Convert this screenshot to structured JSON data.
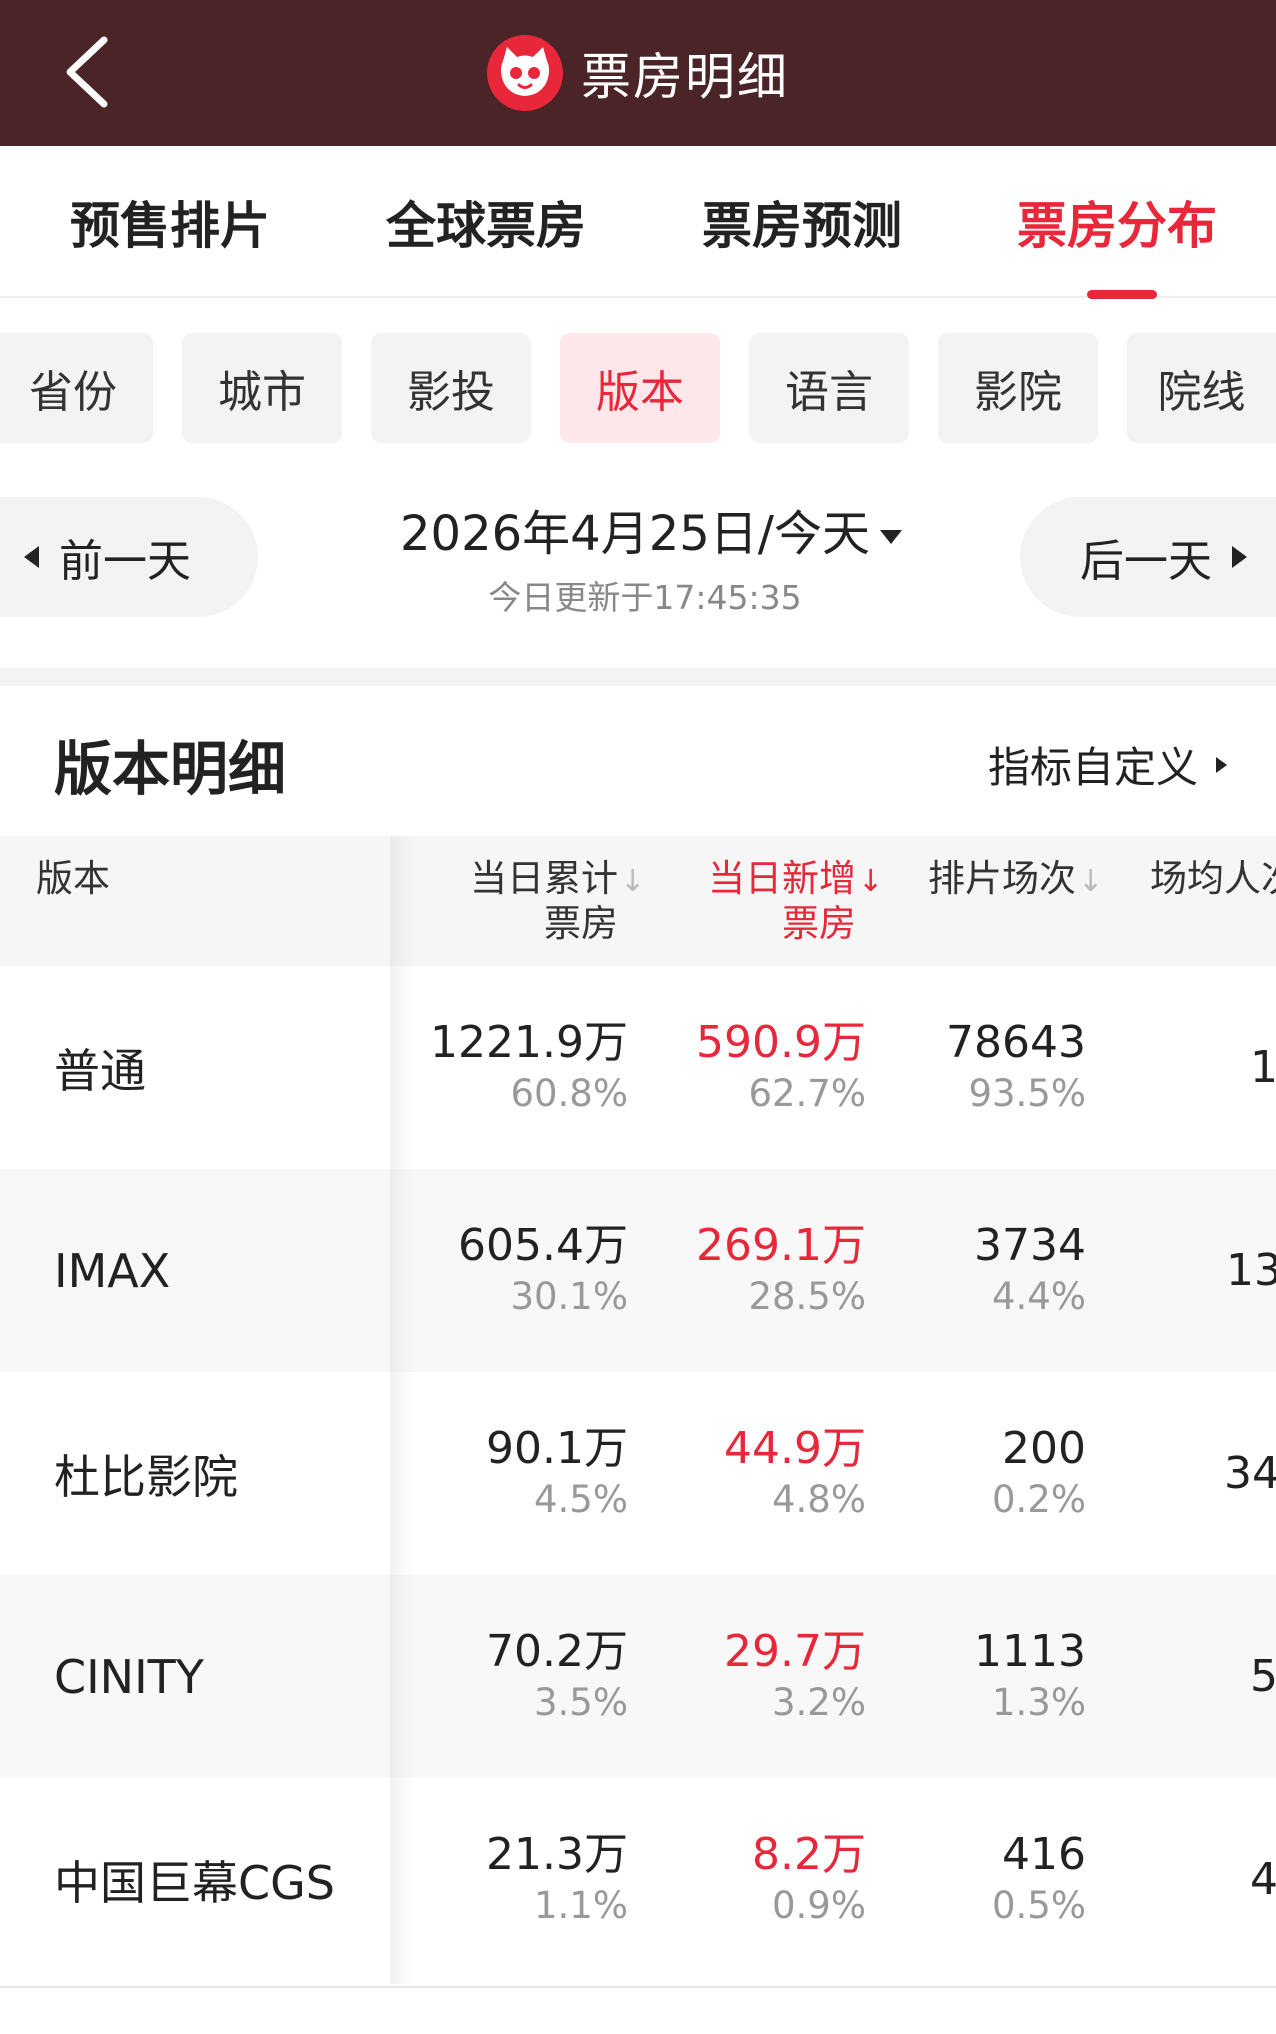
{
  "header": {
    "title": "票房明细"
  },
  "top_tabs": [
    {
      "label": "预售排片",
      "active": false
    },
    {
      "label": "全球票房",
      "active": false
    },
    {
      "label": "票房预测",
      "active": false
    },
    {
      "label": "票房分布",
      "active": true
    }
  ],
  "filters": [
    {
      "label": "省份",
      "active": false
    },
    {
      "label": "城市",
      "active": false
    },
    {
      "label": "影投",
      "active": false
    },
    {
      "label": "版本",
      "active": true
    },
    {
      "label": "语言",
      "active": false
    },
    {
      "label": "影院",
      "active": false
    },
    {
      "label": "院线",
      "active": false
    }
  ],
  "date_nav": {
    "prev_label": "前一天",
    "next_label": "后一天",
    "date_label": "2026年4月25日/今天",
    "updated_label": "今日更新于17:45:35"
  },
  "section": {
    "title": "版本明细",
    "customize_label": "指标自定义"
  },
  "table": {
    "columns": {
      "name": "版本",
      "cumulative": [
        "当日累计",
        "票房"
      ],
      "new": [
        "当日新增",
        "票房"
      ],
      "shows": "排片场次",
      "avg_people": "场均人次"
    },
    "rows": [
      {
        "name": "普通",
        "cumulative": "1221.9万",
        "cumulative_pct": "60.8%",
        "new": "590.9万",
        "new_pct": "62.7%",
        "shows": "78643",
        "shows_pct": "93.5%",
        "avg_cut": "1"
      },
      {
        "name": "IMAX",
        "cumulative": "605.4万",
        "cumulative_pct": "30.1%",
        "new": "269.1万",
        "new_pct": "28.5%",
        "shows": "3734",
        "shows_pct": "4.4%",
        "avg_cut": "13"
      },
      {
        "name": "杜比影院",
        "cumulative": "90.1万",
        "cumulative_pct": "4.5%",
        "new": "44.9万",
        "new_pct": "4.8%",
        "shows": "200",
        "shows_pct": "0.2%",
        "avg_cut": "34"
      },
      {
        "name": "CINITY",
        "cumulative": "70.2万",
        "cumulative_pct": "3.5%",
        "new": "29.7万",
        "new_pct": "3.2%",
        "shows": "1113",
        "shows_pct": "1.3%",
        "avg_cut": "5"
      },
      {
        "name": "中国巨幕CGS",
        "cumulative": "21.3万",
        "cumulative_pct": "1.1%",
        "new": "8.2万",
        "new_pct": "0.9%",
        "shows": "416",
        "shows_pct": "0.5%",
        "avg_cut": "4"
      }
    ]
  },
  "colors": {
    "header_bg": "#4a2427",
    "accent": "#e8283a"
  }
}
